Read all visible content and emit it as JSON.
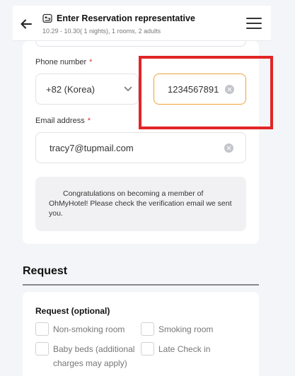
{
  "header": {
    "title": "Enter Reservation representative",
    "subtitle": "10.29 - 10.30( 1 nights), 1 rooms, 2 adults",
    "back_icon": "arrow-left-icon",
    "hotel_icon": "hotel-icon",
    "menu_icon": "hamburger-menu-icon"
  },
  "form": {
    "phone_label": "Phone number",
    "required_mark": "*",
    "country_code": "+82 (Korea)",
    "phone_value": "1234567891",
    "email_label": "Email address",
    "email_value": "tracy7@tupmail.com",
    "notice": "Congratulations on becoming a member of OhMyHotel! Please check the verification email we sent you."
  },
  "request": {
    "heading": "Request",
    "label": "Request (optional)",
    "options": [
      "Non-smoking room",
      "Smoking room",
      "Baby beds (additional charges may apply)",
      "Late Check in"
    ]
  },
  "colors": {
    "accent": "#f0a23a",
    "required": "#e0322e",
    "highlight": "#e22425"
  }
}
